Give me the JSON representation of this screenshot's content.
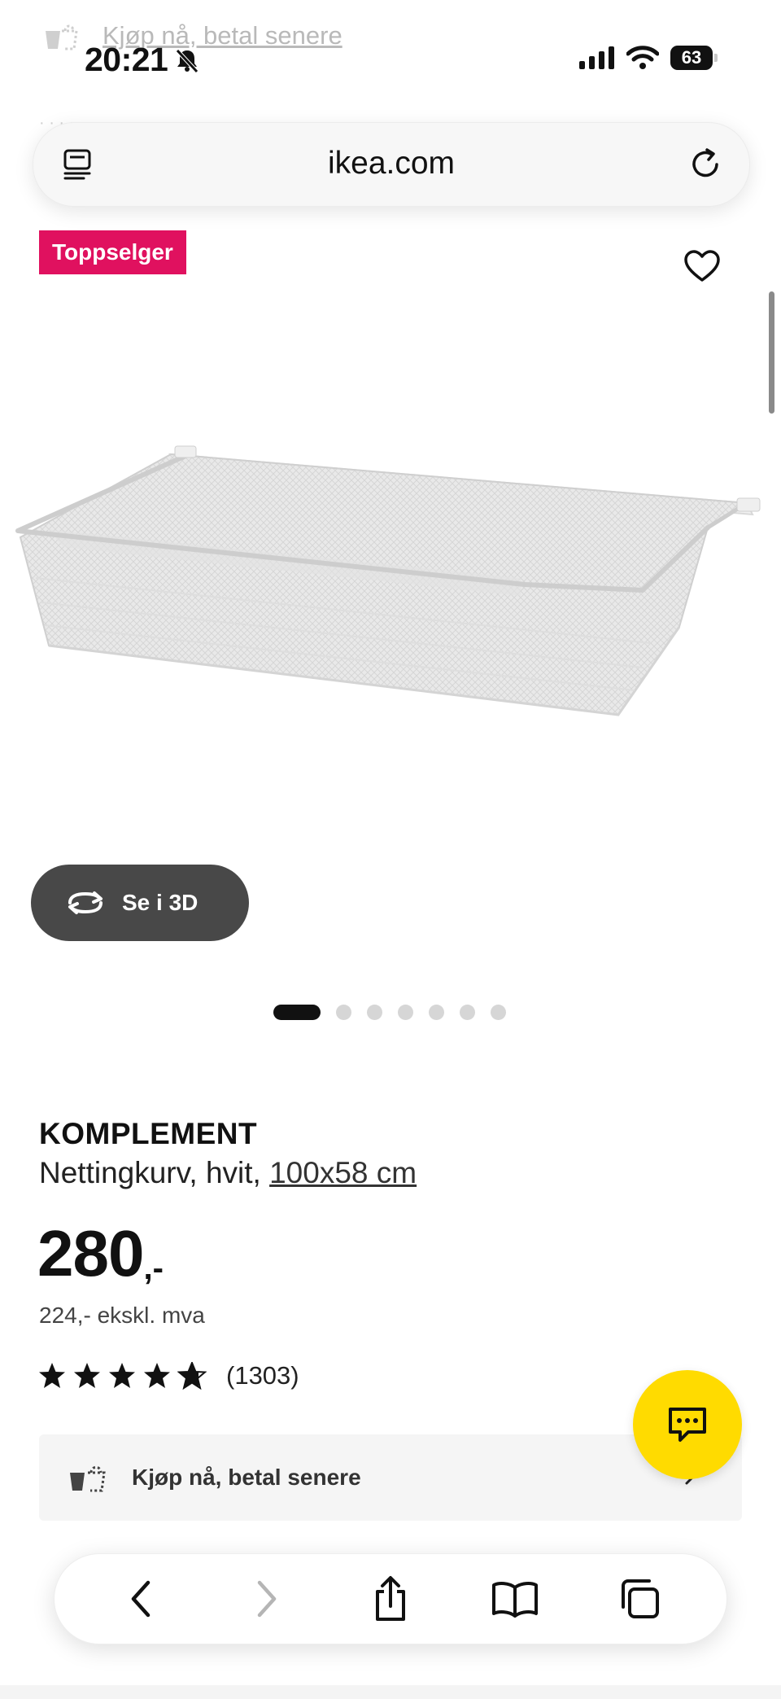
{
  "ghost_header": {
    "text": "Kjøp nå, betal senere",
    "subtext": "· · · · · · · · · · · · · · · · · · · · · · · · ·"
  },
  "status_bar": {
    "time": "20:21",
    "battery": "63"
  },
  "browser": {
    "url": "ikea.com"
  },
  "product": {
    "badge": "Toppselger",
    "view_3d_label": "Se i 3D",
    "carousel": {
      "total": 7,
      "active_index": 0
    },
    "name": "KOMPLEMENT",
    "description": "Nettingkurv, hvit,",
    "size": "100x58 cm",
    "price": "280",
    "price_suffix": ",-",
    "price_ex_vat": "224,- ekskl. mva",
    "rating": {
      "value": 4.7,
      "max": 5,
      "count": "(1303)"
    }
  },
  "bnpl": {
    "label": "Kjøp nå, betal senere"
  },
  "colors": {
    "badge": "#e0115f",
    "chat": "#ffdb00",
    "button_3d": "#484848"
  },
  "icons": {
    "reader": "reader-icon",
    "reload": "reload-icon",
    "heart": "heart-icon",
    "rotate": "rotate-3d-icon",
    "chat": "chat-icon",
    "bnpl": "bag-dashed-icon",
    "back": "chevron-left-icon",
    "forward": "chevron-right-icon",
    "share": "share-icon",
    "bookmarks": "book-icon",
    "tabs": "tabs-icon"
  }
}
